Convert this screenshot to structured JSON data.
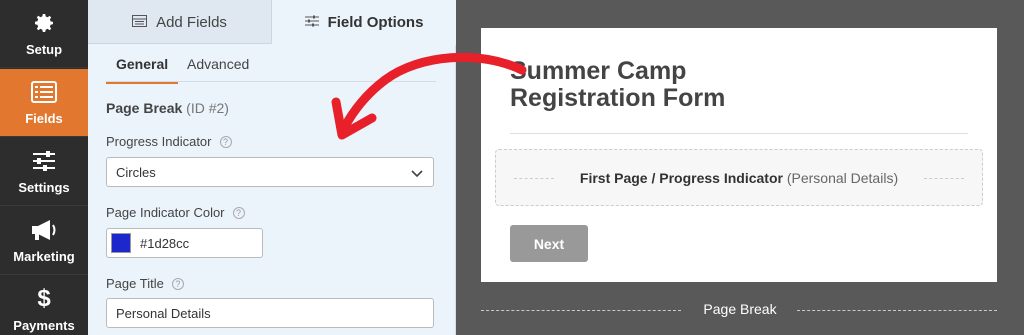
{
  "sidebar": {
    "items": [
      {
        "label": "Setup",
        "icon": "gear-icon",
        "active": false
      },
      {
        "label": "Fields",
        "icon": "list-icon",
        "active": true
      },
      {
        "label": "Settings",
        "icon": "sliders-icon",
        "active": false
      },
      {
        "label": "Marketing",
        "icon": "megaphone-icon",
        "active": false
      },
      {
        "label": "Payments",
        "icon": "dollar-icon",
        "active": false
      }
    ]
  },
  "panel": {
    "tabs": {
      "add_fields": "Add Fields",
      "field_options": "Field Options"
    },
    "subtabs": {
      "general": "General",
      "advanced": "Advanced"
    },
    "field": {
      "name": "Page Break",
      "id_text": "(ID #2)"
    },
    "progress_indicator": {
      "label": "Progress Indicator",
      "value": "Circles"
    },
    "page_indicator_color": {
      "label": "Page Indicator Color",
      "value": "#1d28cc"
    },
    "page_title": {
      "label": "Page Title",
      "value": "Personal Details"
    }
  },
  "preview": {
    "form_title": "Summer Camp Registration Form",
    "page_break_box": {
      "strong": "First Page / Progress Indicator",
      "muted": "(Personal Details)"
    },
    "next_button": "Next",
    "page_break_label": "Page Break"
  },
  "colors": {
    "accent": "#e27730",
    "sidebar_bg": "#2d2d2d",
    "annotation_arrow": "#e8202a",
    "indicator_swatch": "#1d28cc"
  }
}
